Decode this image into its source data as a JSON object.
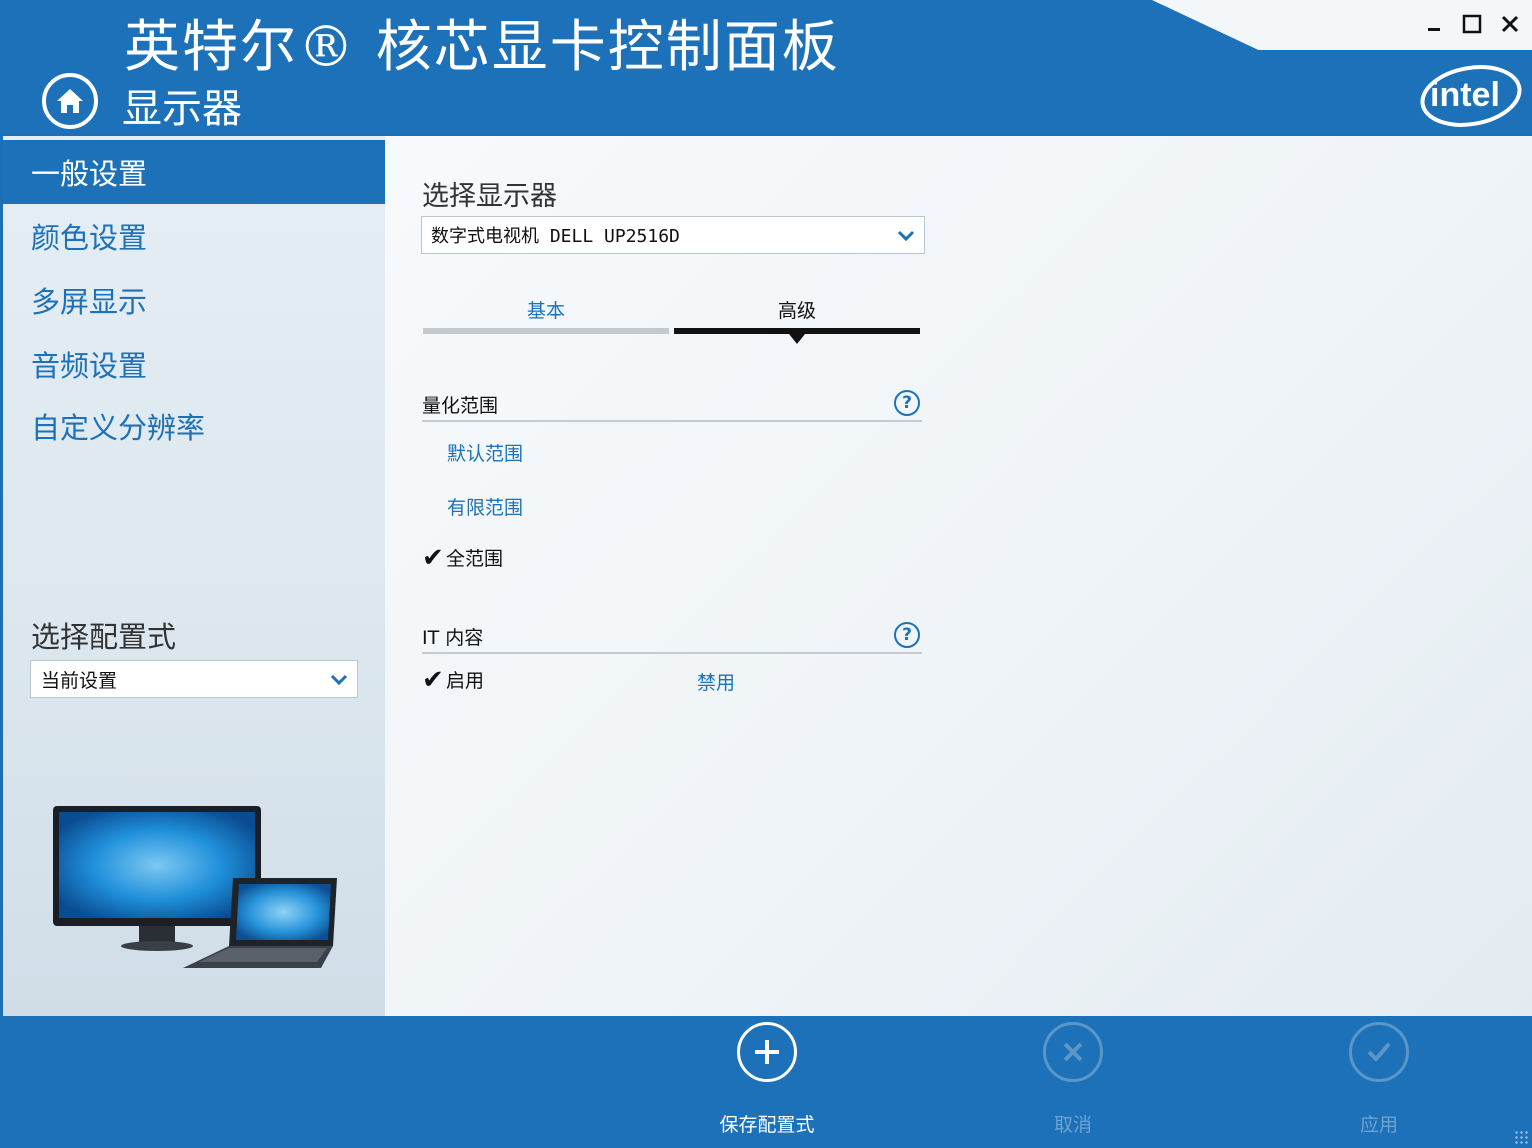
{
  "window": {
    "title": "英特尔® 核芯显卡控制面板",
    "page_title": "显示器",
    "controls": {
      "minimize": "_",
      "maximize": "□",
      "close": "✕"
    },
    "logo_text": "intel"
  },
  "sidebar": {
    "items": [
      {
        "label": "一般设置",
        "active": true
      },
      {
        "label": "颜色设置",
        "active": false
      },
      {
        "label": "多屏显示",
        "active": false
      },
      {
        "label": "音频设置",
        "active": false
      },
      {
        "label": "自定义分辨率",
        "active": false
      }
    ],
    "profile_label": "选择配置式",
    "profile_value": "当前设置"
  },
  "main": {
    "select_display_label": "选择显示器",
    "display_value": "数字式电视机 DELL UP2516D",
    "tabs": [
      {
        "label": "基本",
        "active": false
      },
      {
        "label": "高级",
        "active": true
      }
    ],
    "quantization": {
      "title": "量化范围",
      "help": "?",
      "options": [
        {
          "label": "默认范围",
          "selected": false
        },
        {
          "label": "有限范围",
          "selected": false
        },
        {
          "label": "全范围",
          "selected": true
        }
      ]
    },
    "it_content": {
      "title": "IT 内容",
      "help": "?",
      "options": [
        {
          "label": "启用",
          "selected": true
        },
        {
          "label": "禁用",
          "selected": false
        }
      ]
    },
    "check_mark": "✔"
  },
  "footer": {
    "save_label": "保存配置式",
    "cancel_label": "取消",
    "apply_label": "应用"
  },
  "colors": {
    "brand_blue": "#1c71b8",
    "disabled_blue": "#6ea2cf"
  }
}
